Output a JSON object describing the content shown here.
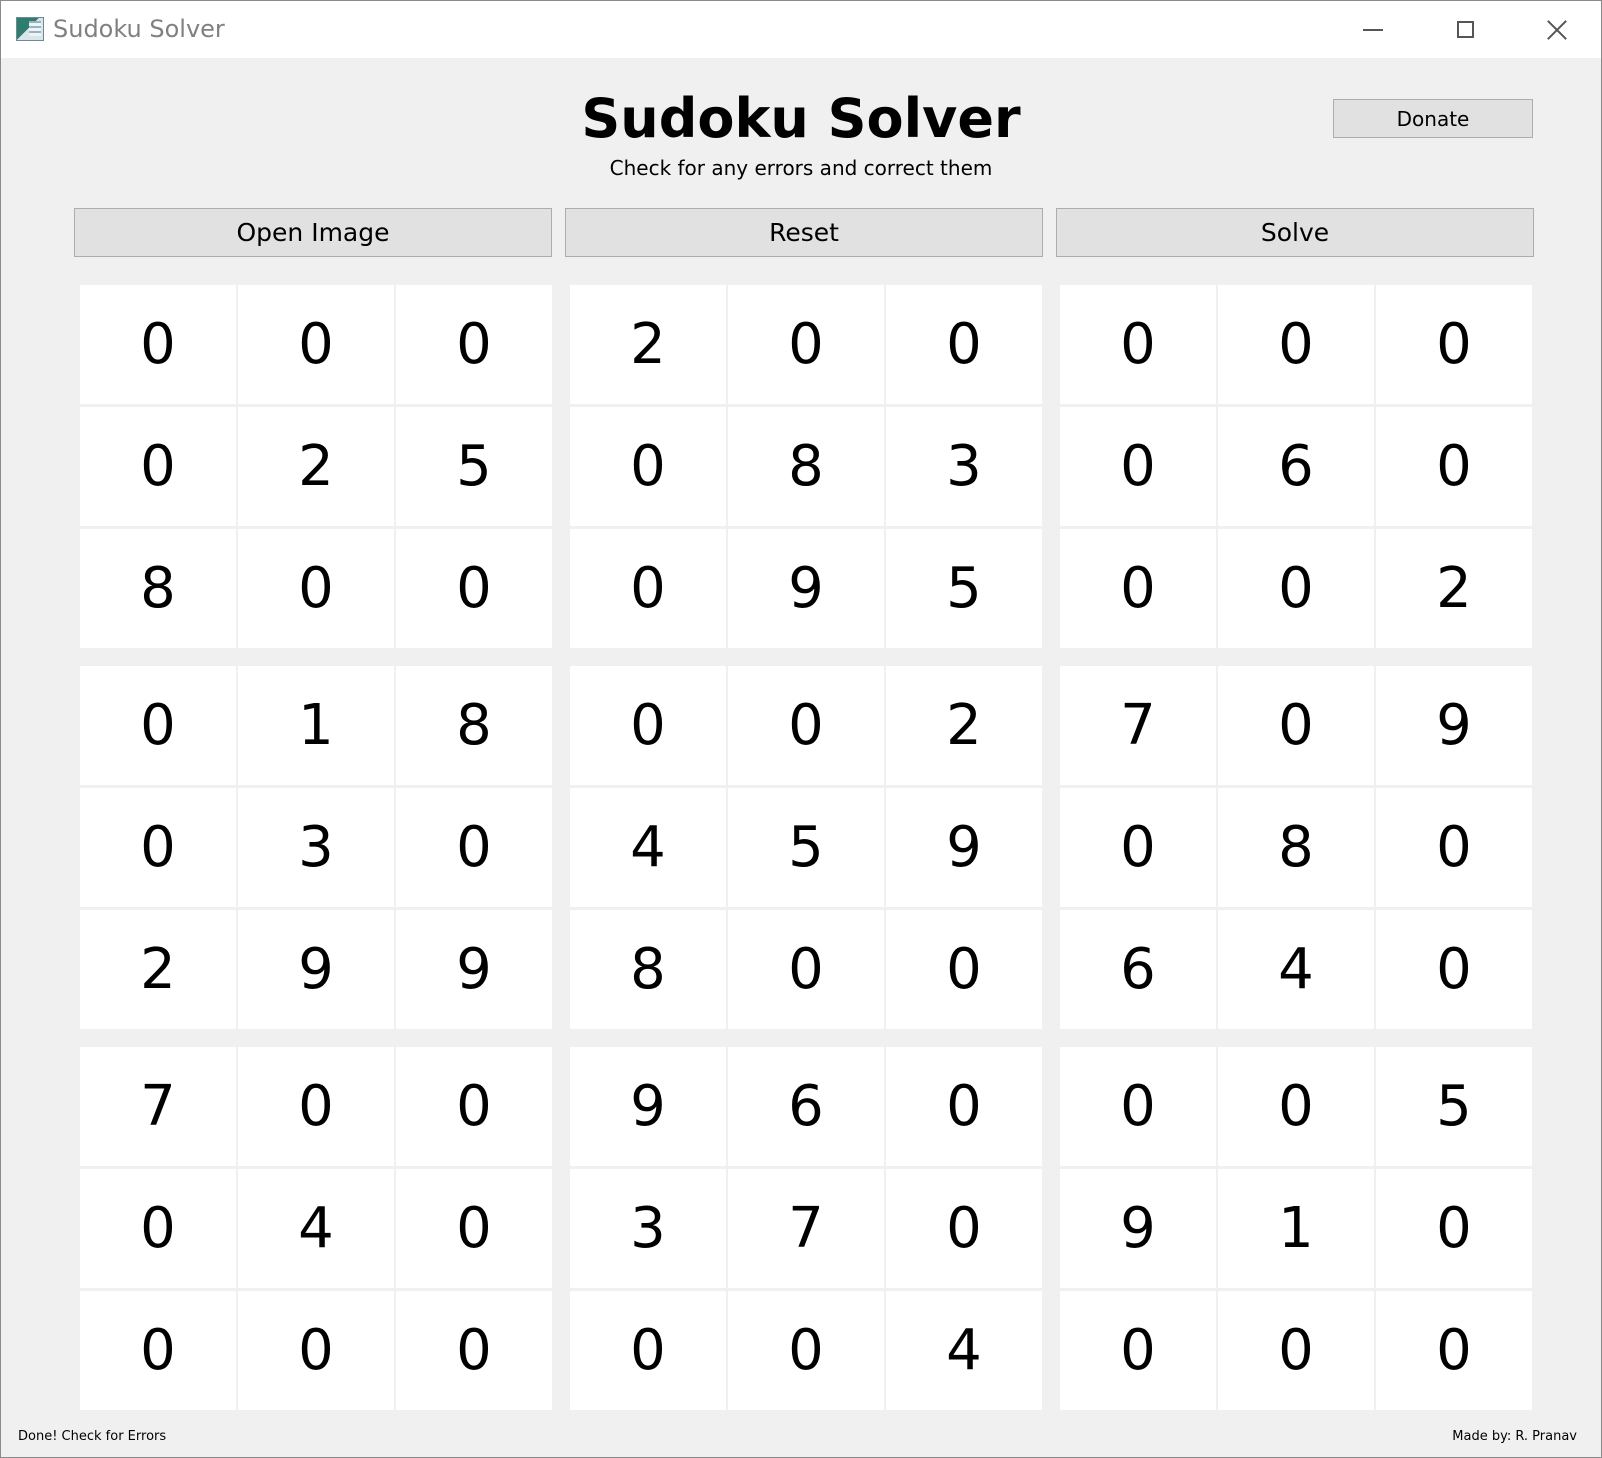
{
  "window": {
    "title": "Sudoku Solver"
  },
  "header": {
    "title": "Sudoku Solver",
    "subtitle": "Check for any errors and correct them",
    "donate_label": "Donate"
  },
  "toolbar": {
    "open_label": "Open Image",
    "reset_label": "Reset",
    "solve_label": "Solve"
  },
  "grid": [
    [
      "0",
      "0",
      "0",
      "2",
      "0",
      "0",
      "0",
      "0",
      "0"
    ],
    [
      "0",
      "2",
      "5",
      "0",
      "8",
      "3",
      "0",
      "6",
      "0"
    ],
    [
      "8",
      "0",
      "0",
      "0",
      "9",
      "5",
      "0",
      "0",
      "2"
    ],
    [
      "0",
      "1",
      "8",
      "0",
      "0",
      "2",
      "7",
      "0",
      "9"
    ],
    [
      "0",
      "3",
      "0",
      "4",
      "5",
      "9",
      "0",
      "8",
      "0"
    ],
    [
      "2",
      "9",
      "9",
      "8",
      "0",
      "0",
      "6",
      "4",
      "0"
    ],
    [
      "7",
      "0",
      "0",
      "9",
      "6",
      "0",
      "0",
      "0",
      "5"
    ],
    [
      "0",
      "4",
      "0",
      "3",
      "7",
      "0",
      "9",
      "1",
      "0"
    ],
    [
      "0",
      "0",
      "0",
      "0",
      "0",
      "4",
      "0",
      "0",
      "0"
    ]
  ],
  "status": {
    "left": "Done! Check for Errors",
    "right": "Made by: R. Pranav"
  }
}
